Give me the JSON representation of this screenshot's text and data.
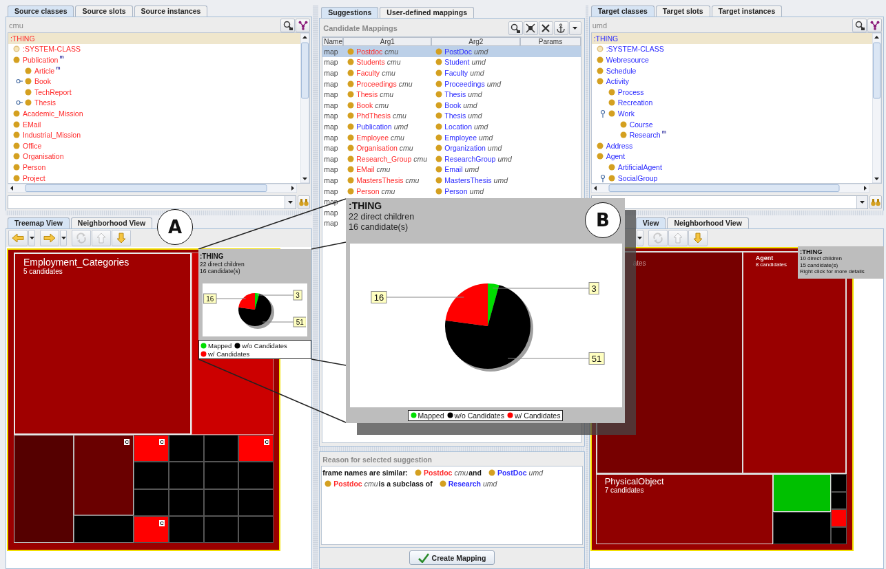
{
  "source": {
    "tabs": [
      {
        "label": "Source classes",
        "selected": true
      },
      {
        "label": "Source slots",
        "selected": false
      },
      {
        "label": "Source instances",
        "selected": false
      }
    ],
    "ontology": "cmu",
    "kind": "source",
    "tree": [
      {
        "label": ":THING",
        "kind": "root",
        "selected": true,
        "children": [
          {
            "label": ":SYSTEM-CLASS",
            "kind": "system",
            "selected": false
          },
          {
            "label": "Publication",
            "kind": "class",
            "badge": "m",
            "selected": false,
            "children": [
              {
                "label": "Article",
                "kind": "class",
                "badge": "m",
                "selected": false
              },
              {
                "label": "Book",
                "kind": "class",
                "expanded": false,
                "selected": false
              },
              {
                "label": "TechReport",
                "kind": "class",
                "selected": false
              },
              {
                "label": "Thesis",
                "kind": "class",
                "expanded": false,
                "selected": false
              }
            ]
          },
          {
            "label": "Academic_Mission",
            "kind": "class",
            "selected": false
          },
          {
            "label": "EMail",
            "kind": "class",
            "selected": false
          },
          {
            "label": "Industrial_Mission",
            "kind": "class",
            "selected": false
          },
          {
            "label": "Office",
            "kind": "class",
            "selected": false
          },
          {
            "label": "Organisation",
            "kind": "class",
            "selected": false
          },
          {
            "label": "Person",
            "kind": "class",
            "selected": false
          },
          {
            "label": "Project",
            "kind": "class",
            "selected": false
          }
        ]
      }
    ]
  },
  "source_views": {
    "tabs": [
      {
        "label": "Treemap View",
        "selected": true
      },
      {
        "label": "Neighborhood View",
        "selected": false
      }
    ],
    "toolbar": [
      {
        "kind": "back",
        "disabled": false
      },
      {
        "kind": "menu",
        "disabled": false
      },
      {
        "kind": "forward",
        "disabled": false
      },
      {
        "kind": "menu",
        "disabled": false
      },
      {
        "kind": "refresh",
        "disabled": true
      },
      {
        "kind": "up",
        "disabled": true
      },
      {
        "kind": "down",
        "disabled": false
      }
    ],
    "treemap": {
      "cells": [
        {
          "label": "Employment_Categories",
          "detail": "5 candidates",
          "color": "#a00000"
        },
        {
          "color": "#cc0000"
        },
        {
          "color": "#550000"
        },
        {
          "color": "#6a0000",
          "badge": "C"
        },
        {
          "color": "#000000"
        },
        {
          "color": "#ff0000",
          "badge": "C"
        },
        {
          "color": "#000000"
        },
        {
          "color": "#000000"
        },
        {
          "color": "#ff0000",
          "badge": "C"
        },
        {
          "color": "#000000"
        },
        {
          "color": "#000000"
        },
        {
          "color": "#000000"
        },
        {
          "color": "#000000"
        },
        {
          "color": "#000000"
        },
        {
          "color": "#000000"
        },
        {
          "color": "#000000"
        },
        {
          "color": "#000000"
        },
        {
          "color": "#ff0000",
          "badge": "C"
        },
        {
          "color": "#000000"
        },
        {
          "color": "#000000"
        },
        {
          "color": "#000000"
        }
      ]
    },
    "tooltip": {
      "title": ":THING",
      "lines": [
        "22 direct children",
        "16 candidate(s)"
      ],
      "chart_data": {
        "type": "pie",
        "categories": [
          "Mapped",
          "w/o Candidates",
          "w/ Candidates"
        ],
        "values": [
          3,
          51,
          16
        ],
        "colors": [
          "#00dd00",
          "#000000",
          "#ff0000"
        ],
        "data_labels": true
      }
    }
  },
  "callouts": [
    {
      "label": "A"
    },
    {
      "label": "B"
    }
  ],
  "suggestions": {
    "tabs": [
      {
        "label": "Suggestions",
        "selected": true
      },
      {
        "label": "User-defined mappings",
        "selected": false
      }
    ],
    "title": "Candidate Mappings",
    "toolbar": [
      {
        "kind": "search"
      },
      {
        "kind": "expand"
      },
      {
        "kind": "close"
      },
      {
        "kind": "anchor"
      },
      {
        "kind": "menu"
      }
    ],
    "columns": [
      "Name",
      "Arg1",
      "Arg2",
      "Params"
    ],
    "rows": [
      {
        "name": "map",
        "arg1": {
          "name": "Postdoc",
          "ontology": "cmu",
          "kind": "source"
        },
        "arg2": {
          "name": "PostDoc",
          "ontology": "umd",
          "kind": "target"
        },
        "selected": true
      },
      {
        "name": "map",
        "arg1": {
          "name": "Students",
          "ontology": "cmu",
          "kind": "source"
        },
        "arg2": {
          "name": "Student",
          "ontology": "umd",
          "kind": "target"
        },
        "selected": false
      },
      {
        "name": "map",
        "arg1": {
          "name": "Faculty",
          "ontology": "cmu",
          "kind": "source"
        },
        "arg2": {
          "name": "Faculty",
          "ontology": "umd",
          "kind": "target"
        },
        "selected": false
      },
      {
        "name": "map",
        "arg1": {
          "name": "Proceedings",
          "ontology": "cmu",
          "kind": "source"
        },
        "arg2": {
          "name": "Proceedings",
          "ontology": "umd",
          "kind": "target"
        },
        "selected": false
      },
      {
        "name": "map",
        "arg1": {
          "name": "Thesis",
          "ontology": "cmu",
          "kind": "source"
        },
        "arg2": {
          "name": "Thesis",
          "ontology": "umd",
          "kind": "target"
        },
        "selected": false
      },
      {
        "name": "map",
        "arg1": {
          "name": "Book",
          "ontology": "cmu",
          "kind": "source"
        },
        "arg2": {
          "name": "Book",
          "ontology": "umd",
          "kind": "target"
        },
        "selected": false
      },
      {
        "name": "map",
        "arg1": {
          "name": "PhdThesis",
          "ontology": "cmu",
          "kind": "source"
        },
        "arg2": {
          "name": "Thesis",
          "ontology": "umd",
          "kind": "target"
        },
        "selected": false
      },
      {
        "name": "map",
        "arg1": {
          "name": "Publication",
          "ontology": "umd",
          "kind": "target"
        },
        "arg2": {
          "name": "Location",
          "ontology": "umd",
          "kind": "target"
        },
        "selected": false
      },
      {
        "name": "map",
        "arg1": {
          "name": "Employee",
          "ontology": "cmu",
          "kind": "source"
        },
        "arg2": {
          "name": "Employee",
          "ontology": "umd",
          "kind": "target"
        },
        "selected": false
      },
      {
        "name": "map",
        "arg1": {
          "name": "Organisation",
          "ontology": "cmu",
          "kind": "source"
        },
        "arg2": {
          "name": "Organization",
          "ontology": "umd",
          "kind": "target"
        },
        "selected": false
      },
      {
        "name": "map",
        "arg1": {
          "name": "Research_Group",
          "ontology": "cmu",
          "kind": "source"
        },
        "arg2": {
          "name": "ResearchGroup",
          "ontology": "umd",
          "kind": "target"
        },
        "selected": false
      },
      {
        "name": "map",
        "arg1": {
          "name": "EMail",
          "ontology": "cmu",
          "kind": "source"
        },
        "arg2": {
          "name": "Email",
          "ontology": "umd",
          "kind": "target"
        },
        "selected": false
      },
      {
        "name": "map",
        "arg1": {
          "name": "MastersThesis",
          "ontology": "cmu",
          "kind": "source"
        },
        "arg2": {
          "name": "MastersThesis",
          "ontology": "umd",
          "kind": "target"
        },
        "selected": false
      },
      {
        "name": "map",
        "arg1": {
          "name": "Person",
          "ontology": "cmu",
          "kind": "source"
        },
        "arg2": {
          "name": "Person",
          "ontology": "umd",
          "kind": "target"
        },
        "selected": false
      },
      {
        "name": "map",
        "selected": false
      },
      {
        "name": "map",
        "selected": false
      },
      {
        "name": "map",
        "selected": false
      }
    ]
  },
  "zoom_popup": {
    "title": ":THING",
    "lines": [
      "22 direct children",
      "16 candidate(s)"
    ],
    "chart_data": {
      "type": "pie",
      "categories": [
        "Mapped",
        "w/o Candidates",
        "w/ Candidates"
      ],
      "values": [
        3,
        51,
        16
      ],
      "colors": [
        "#00dd00",
        "#000000",
        "#ff0000"
      ],
      "data_labels": true
    }
  },
  "reason": {
    "title": "Reason for selected suggestion",
    "lines": [
      {
        "parts": [
          {
            "kind": "text",
            "text": "frame names are similar:"
          },
          {
            "kind": "source",
            "name": "Postdoc",
            "ontology": "cmu"
          },
          {
            "kind": "text",
            "text": "and"
          },
          {
            "kind": "target",
            "name": "PostDoc",
            "ontology": "umd"
          }
        ]
      },
      {
        "parts": [
          {
            "kind": "source",
            "name": "Postdoc",
            "ontology": "cmu"
          },
          {
            "kind": "text",
            "text": "is a subclass of"
          },
          {
            "kind": "target",
            "name": "Research",
            "ontology": "umd"
          }
        ]
      }
    ]
  },
  "create_button": {
    "label": "Create Mapping"
  },
  "target": {
    "tabs": [
      {
        "label": "Target classes",
        "selected": true
      },
      {
        "label": "Target slots",
        "selected": false
      },
      {
        "label": "Target instances",
        "selected": false
      }
    ],
    "ontology": "umd",
    "kind": "target",
    "tree": [
      {
        "label": ":THING",
        "kind": "root",
        "selected": true,
        "children": [
          {
            "label": ":SYSTEM-CLASS",
            "kind": "system",
            "selected": false
          },
          {
            "label": "Webresource",
            "kind": "class",
            "selected": false
          },
          {
            "label": "Schedule",
            "kind": "class",
            "selected": false
          },
          {
            "label": "Activity",
            "kind": "class",
            "selected": false,
            "children": [
              {
                "label": "Process",
                "kind": "class",
                "selected": false
              },
              {
                "label": "Recreation",
                "kind": "class",
                "selected": false
              },
              {
                "label": "Work",
                "kind": "class",
                "expanded": true,
                "selected": false,
                "children": [
                  {
                    "label": "Course",
                    "kind": "class",
                    "selected": false
                  },
                  {
                    "label": "Research",
                    "kind": "class",
                    "badge": "m",
                    "selected": false
                  }
                ]
              }
            ]
          },
          {
            "label": "Address",
            "kind": "class",
            "selected": false
          },
          {
            "label": "Agent",
            "kind": "class",
            "selected": false,
            "children": [
              {
                "label": "ArtificialAgent",
                "kind": "class",
                "selected": false
              },
              {
                "label": "SocialGroup",
                "kind": "class",
                "expanded": true,
                "selected": false
              }
            ]
          }
        ]
      }
    ]
  },
  "target_views": {
    "tabs": [
      {
        "label": "View",
        "selected": true
      },
      {
        "label": "Neighborhood View",
        "selected": false
      }
    ],
    "toolbar": [
      {
        "kind": "menu",
        "disabled": false
      },
      {
        "kind": "refresh",
        "disabled": true
      },
      {
        "kind": "up",
        "disabled": true
      },
      {
        "kind": "down",
        "disabled": false
      }
    ],
    "treemap": {
      "cells": [
        {
          "detail": "ates",
          "color": "#770000"
        },
        {
          "label": "Agent",
          "detail": "8 candidates",
          "color": "#990000"
        },
        {
          "label": "PhysicalObject",
          "detail": "7 candidates",
          "color": "#900000"
        },
        {
          "color": "#00c000"
        },
        {
          "color": "#000000"
        },
        {
          "color": "#000000"
        },
        {
          "color": "#000000"
        },
        {
          "color": "#ff0000"
        },
        {
          "color": "#000000"
        }
      ]
    },
    "tooltip": {
      "title": ":THING",
      "lines": [
        "10 direct children",
        "15 candidate(s)",
        "Right click for more details"
      ]
    }
  }
}
